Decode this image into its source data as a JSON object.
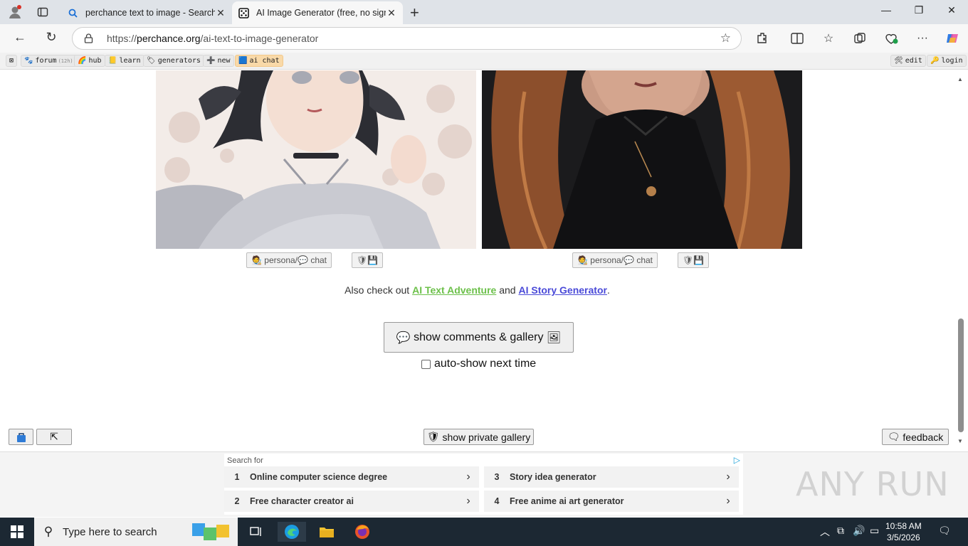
{
  "browser": {
    "tabs": [
      {
        "title": "perchance text to image - Search",
        "active": false
      },
      {
        "title": "AI Image Generator (free, no sign",
        "active": true
      }
    ],
    "url_prefix": "https://",
    "url_domain": "perchance.org",
    "url_path": "/ai-text-to-image-generator"
  },
  "perchance_bar": {
    "close_label": "⊠",
    "items": [
      {
        "icon": "forum-icon",
        "label": "forum",
        "count": "(12h)"
      },
      {
        "icon": "hub-icon",
        "label": "hub"
      },
      {
        "icon": "learn-icon",
        "label": "learn"
      },
      {
        "icon": "generators-icon",
        "label": "generators"
      },
      {
        "icon": "new-icon",
        "label": "new"
      },
      {
        "icon": "ai-chat-icon",
        "label": "ai chat"
      }
    ],
    "right_items": [
      {
        "icon": "edit-icon",
        "label": "edit"
      },
      {
        "icon": "login-icon",
        "label": "login"
      }
    ]
  },
  "image_cards": [
    {
      "persona_label": "persona",
      "sep": " / ",
      "chat_label": "chat"
    },
    {
      "persona_label": "persona",
      "sep": " / ",
      "chat_label": "chat"
    }
  ],
  "also_check": {
    "prefix": "Also check out ",
    "link1": "AI Text Adventure",
    "middle": " and ",
    "link2": "AI Story Generator",
    "suffix": "."
  },
  "gallery": {
    "show_button": "show comments & gallery",
    "auto_show_label": "auto-show next time",
    "auto_show_checked": false,
    "private_gallery_button": "show private gallery",
    "feedback_button": "feedback",
    "top_button": "⇱"
  },
  "ad": {
    "search_for": "Search for",
    "items": [
      {
        "num": "1",
        "text": "Online computer science degree"
      },
      {
        "num": "2",
        "text": "Free character creator ai"
      },
      {
        "num": "3",
        "text": "Story idea generator"
      },
      {
        "num": "4",
        "text": "Free anime ai art generator"
      }
    ]
  },
  "watermark": "ANY RUN",
  "taskbar": {
    "search_placeholder": "Type here to search",
    "time": "10:58 AM",
    "date": "3/5/2026"
  },
  "colors": {
    "link_adventure": "#6cc04a",
    "link_story": "#4a4ad8",
    "ai_chat_chip": "#f9d9a8",
    "taskbar": "#1c2833"
  }
}
